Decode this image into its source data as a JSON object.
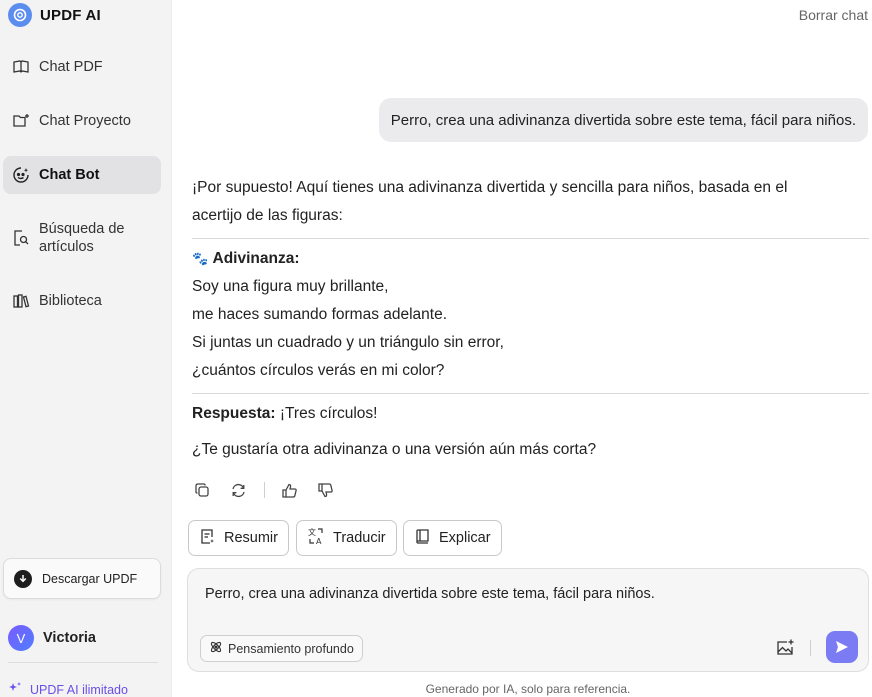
{
  "sidebar": {
    "brand": "UPDF AI",
    "items": [
      {
        "label": "Chat PDF",
        "icon": "book-open-icon"
      },
      {
        "label": "Chat Proyecto",
        "icon": "folder-plus-icon"
      },
      {
        "label": "Chat Bot",
        "icon": "bot-icon",
        "active": true
      },
      {
        "label": "Búsqueda de artículos",
        "icon": "article-search-icon"
      },
      {
        "label": "Biblioteca",
        "icon": "library-icon"
      }
    ],
    "download_label": "Descargar UPDF",
    "user_initial": "V",
    "user_name": "Victoria",
    "upgrade_label": "UPDF AI ilimitado"
  },
  "header": {
    "clear_chat": "Borrar chat"
  },
  "conversation": {
    "user_message": "Perro, crea una adivinanza divertida sobre este tema, fácil para niños.",
    "answer": {
      "intro_line1": "¡Por supuesto! Aquí tienes una adivinanza divertida y sencilla para niños, basada en el",
      "intro_line2": "acertijo de las figuras:",
      "riddle_emoji": "🐾",
      "riddle_title": "Adivinanza:",
      "riddle_lines": [
        "Soy una figura muy brillante,",
        "me haces sumando formas adelante.",
        "Si juntas un cuadrado y un triángulo sin error,",
        "¿cuántos círculos verás en mi color?"
      ],
      "answer_label": "Respuesta:",
      "answer_text": " ¡Tres círculos!",
      "closing": "¿Te gustaría otra adivinanza o una versión aún más corta?"
    }
  },
  "quick_actions": {
    "summarize": "Resumir",
    "translate": "Traducir",
    "explain": "Explicar"
  },
  "composer": {
    "value": "Perro, crea una adivinanza divertida sobre este tema, fácil para niños.",
    "deep_think_label": "Pensamiento profundo"
  },
  "footer_note": "Generado por IA, solo para referencia.",
  "colors": {
    "sidebar_bg": "#f3f3f4",
    "active_item_bg": "#e2e2e5",
    "accent": "#7b7cf3",
    "upgrade_text": "#6a4ee8"
  }
}
